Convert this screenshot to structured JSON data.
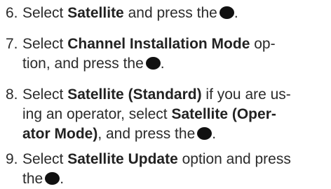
{
  "steps": [
    {
      "num": "6.",
      "lines": [
        {
          "pre": "Select ",
          "bold": "Satellite",
          "post": " and press the"
        }
      ]
    },
    {
      "num": "7.",
      "lines": [
        {
          "pre": "Select ",
          "bold": "Channel Installation Mode",
          "post": " op-"
        },
        {
          "pre": "tion, and press the"
        }
      ]
    },
    {
      "num": "8.",
      "lines": [
        {
          "pre": "Select ",
          "bold": "Satellite (Standard)",
          "post": " if you are us-"
        },
        {
          "pre": "ing an operator, select ",
          "bold": "Satellite (Oper-"
        },
        {
          "bold": "ator Mode)",
          "post": ", and press the"
        }
      ]
    },
    {
      "num": "9.",
      "lines": [
        {
          "pre": "Select ",
          "bold": "Satellite Update",
          "post": " option and press"
        },
        {
          "pre": "the"
        }
      ]
    }
  ],
  "icons": {
    "ok_button": "ok-button-icon"
  },
  "colors": {
    "text": "#2b2b2b",
    "ok_button": "#111111"
  }
}
